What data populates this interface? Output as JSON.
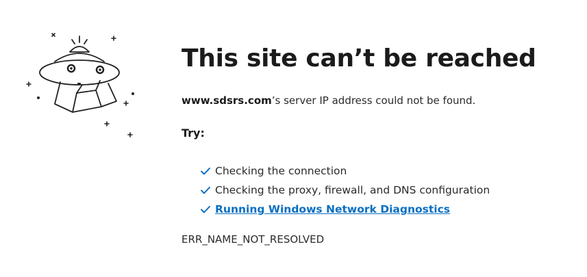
{
  "error_page": {
    "title": "This site can’t be reached",
    "host": "www.sdsrs.com",
    "message_suffix": "’s server IP address could not be found.",
    "try_heading": "Try:",
    "suggestions": [
      "Checking the connection",
      "Checking the proxy, firewall, and DNS configuration"
    ],
    "diagnostics_link": "Running Windows Network Diagnostics",
    "error_code": "ERR_NAME_NOT_RESOLVED"
  },
  "icons": {
    "illustration": "ufo-illustration",
    "check": "checkmark-icon"
  },
  "colors": {
    "link": "#0a6fc2",
    "check": "#0a6fc2",
    "text": "#1b1b1b"
  }
}
